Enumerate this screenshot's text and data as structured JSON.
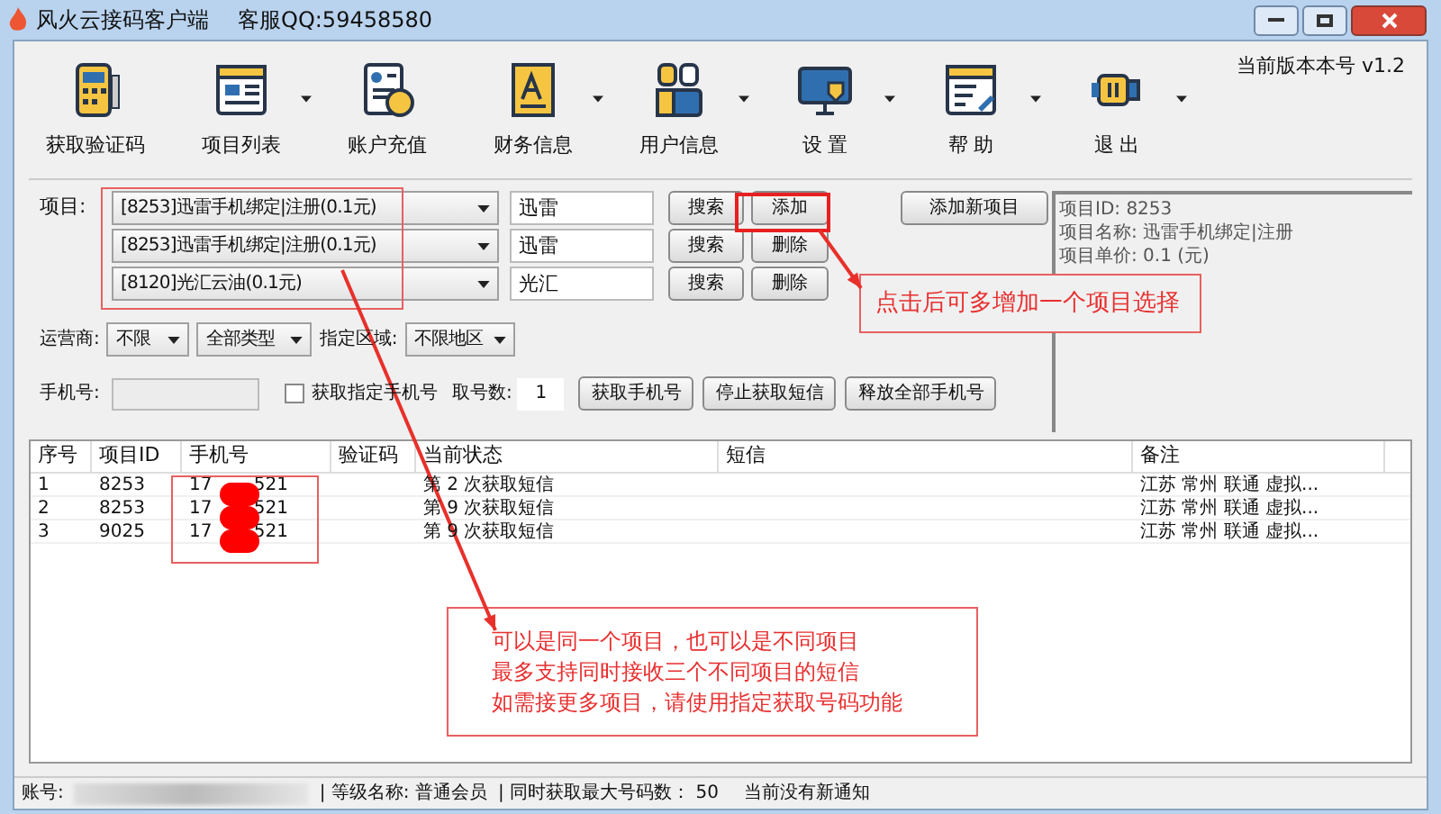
{
  "window": {
    "title": "风火云接码客户端",
    "service": "客服QQ:59458580"
  },
  "version": "当前版本本号 v1.2",
  "toolbar": [
    {
      "label": "获取验证码",
      "has_menu": false
    },
    {
      "label": "项目列表",
      "has_menu": true
    },
    {
      "label": "账户充值",
      "has_menu": false
    },
    {
      "label": "财务信息",
      "has_menu": true
    },
    {
      "label": "用户信息",
      "has_menu": true
    },
    {
      "label": "设 置",
      "has_menu": true
    },
    {
      "label": "帮 助",
      "has_menu": true
    },
    {
      "label": "退 出",
      "has_menu": true
    }
  ],
  "project_label": "项目:",
  "projects": [
    {
      "combo": "[8253]迅雷手机绑定|注册(0.1元)",
      "keyword": "迅雷",
      "search": "搜索",
      "action": "添加"
    },
    {
      "combo": "[8253]迅雷手机绑定|注册(0.1元)",
      "keyword": "迅雷",
      "search": "搜索",
      "action": "删除"
    },
    {
      "combo": "[8120]光汇云油(0.1元)",
      "keyword": "光汇",
      "search": "搜索",
      "action": "删除"
    }
  ],
  "add_project_button": "添加新项目",
  "info": [
    "项目ID: 8253",
    "项目名称: 迅雷手机绑定|注册",
    "项目单价: 0.1 (元)"
  ],
  "filters": {
    "carrier_label": "运营商:",
    "carrier": "不限",
    "type": "全部类型",
    "region_label": "指定区域:",
    "region": "不限地区"
  },
  "phone_row": {
    "label": "手机号:",
    "specify_checkbox": {
      "label": "获取指定手机号",
      "checked": false
    },
    "count_label": "取号数:",
    "count": "1",
    "buttons": [
      "获取手机号",
      "停止获取短信",
      "释放全部手机号"
    ]
  },
  "table": {
    "columns": [
      "序号",
      "项目ID",
      "手机号",
      "验证码",
      "当前状态",
      "短信",
      "备注"
    ],
    "rows": [
      {
        "no": "1",
        "project_id": "8253",
        "phone_start": "17",
        "phone_end": "521",
        "status": "第 2 次获取短信",
        "note": "江苏 常州 联通 虚拟..."
      },
      {
        "no": "2",
        "project_id": "8253",
        "phone_start": "17",
        "phone_end": "521",
        "status": "第 9 次获取短信",
        "note": "江苏 常州 联通 虚拟..."
      },
      {
        "no": "3",
        "project_id": "9025",
        "phone_start": "17",
        "phone_end": "521",
        "status": "第 9 次获取短信",
        "note": "江苏 常州 联通 虚拟..."
      }
    ]
  },
  "annotations": {
    "add_callout": "点击后可多增加一个项目选择",
    "bottom_callout": [
      "可以是同一个项目，也可以是不同项目",
      "最多支持同时接收三个不同项目的短信",
      "如需接更多项目，请使用指定获取号码功能"
    ]
  },
  "status_bar": {
    "account_label": "账号:",
    "level": "| 等级名称:  普通会员",
    "max": "| 同时获取最大号码数：  50",
    "notice": "当前没有新通知"
  }
}
